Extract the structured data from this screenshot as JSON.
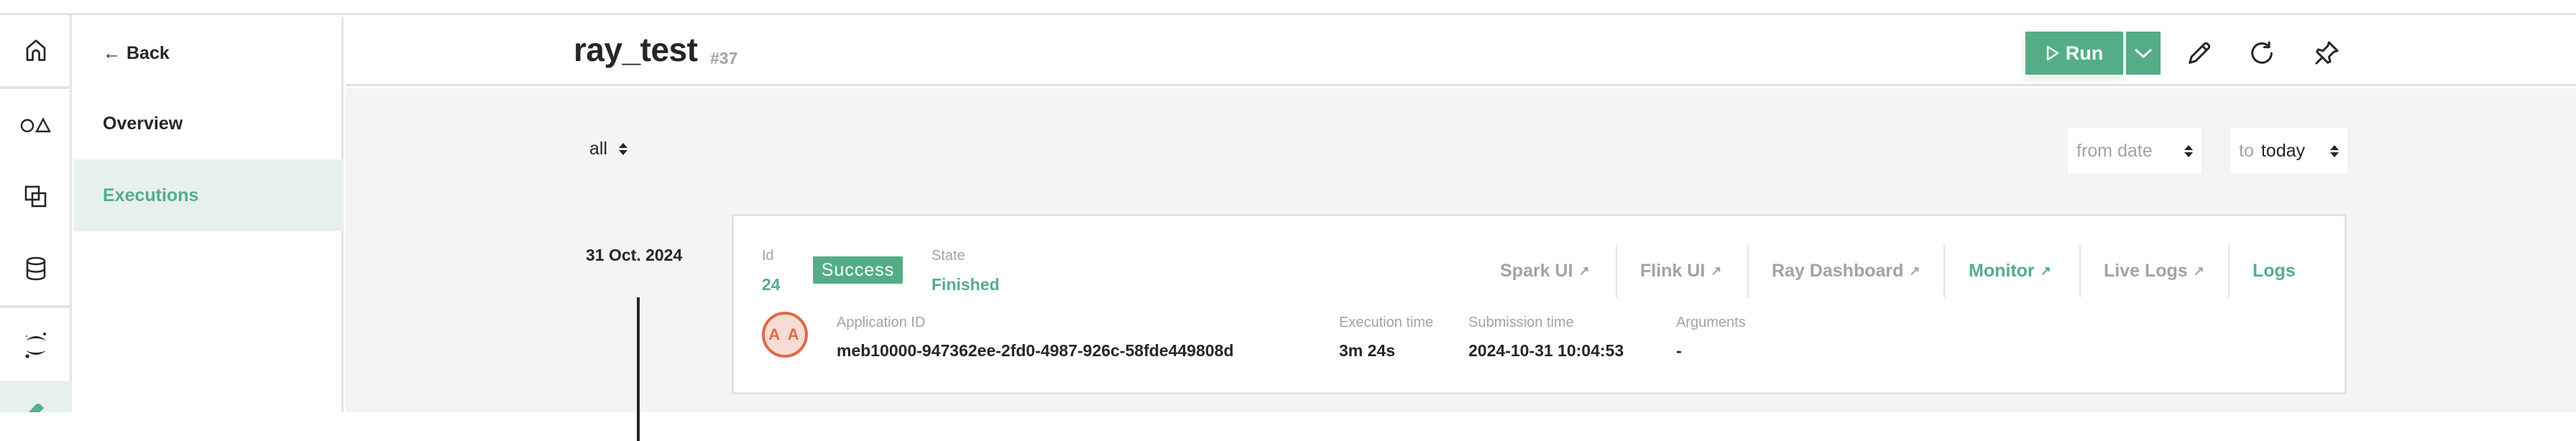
{
  "rail": {
    "items": [
      {
        "icon": "home-icon",
        "active": false
      },
      {
        "icon": "shapes-icon",
        "active": false
      },
      {
        "icon": "copy-layers-icon",
        "active": false
      },
      {
        "icon": "database-icon",
        "active": false
      },
      {
        "icon": "jupyter-icon",
        "active": false
      },
      {
        "icon": "pipeline-icon",
        "active": true
      }
    ]
  },
  "nav": {
    "back_arrow": "←",
    "back_label": "Back",
    "items": [
      {
        "label": "Overview",
        "active": false
      },
      {
        "label": "Executions",
        "active": true
      }
    ]
  },
  "header": {
    "title": "ray_test",
    "id": "#37",
    "run_label": "Run",
    "actions": [
      "edit-icon",
      "refresh-icon",
      "pin-icon"
    ]
  },
  "filters": {
    "status_selected": "all",
    "from_placeholder": "from date",
    "to_prefix": "to",
    "to_value": "today"
  },
  "executions": [
    {
      "date": "31 Oct. 2024",
      "id_label": "Id",
      "id": "24",
      "status": "Success",
      "state_label": "State",
      "state": "Finished",
      "avatar_initials": "A A",
      "application_id_label": "Application ID",
      "application_id": "meb10000-947362ee-2fd0-4987-926c-58fde449808d",
      "execution_time_label": "Execution time",
      "execution_time": "3m 24s",
      "submission_time_label": "Submission time",
      "submission_time": "2024-10-31 10:04:53",
      "arguments_label": "Arguments",
      "arguments": "-",
      "links": [
        {
          "label": "Spark UI",
          "external": "↗",
          "enabled": false
        },
        {
          "label": "Flink UI",
          "external": "↗",
          "enabled": false
        },
        {
          "label": "Ray Dashboard",
          "external": "↗",
          "enabled": false
        },
        {
          "label": "Monitor",
          "external": "↗",
          "enabled": true
        },
        {
          "label": "Live Logs",
          "external": "↗",
          "enabled": false
        },
        {
          "label": "Logs",
          "enabled": true
        }
      ]
    }
  ],
  "colors": {
    "accent": "#55ad87",
    "accent_bg": "#e6f1ee",
    "text": "#262626",
    "muted": "#a3a3a3",
    "border": "#e3e3e3",
    "page_bg": "#f4f4f4",
    "avatar": "#dc6b48"
  }
}
